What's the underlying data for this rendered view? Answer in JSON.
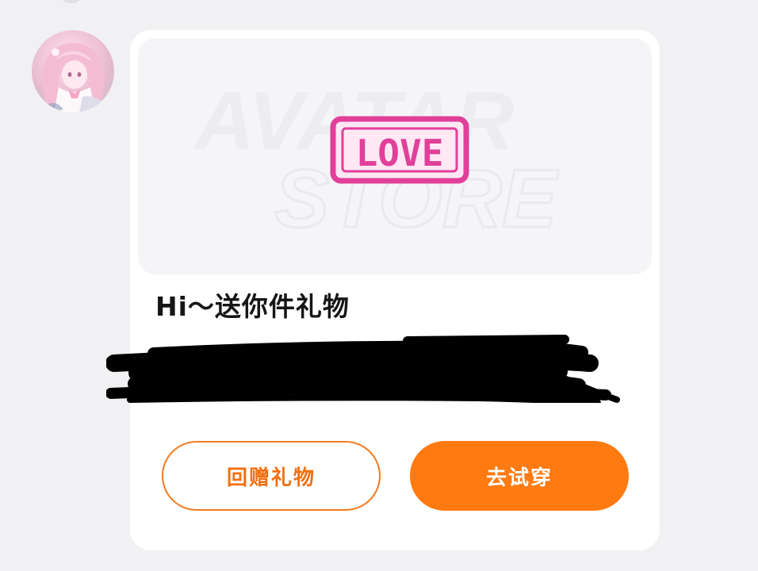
{
  "chat": {
    "sender_avatar": "anime-girl-avatar",
    "gift_card": {
      "banner": {
        "watermark_line1": "AVATAR",
        "watermark_line2": "STORE",
        "badge_text": "LOVE"
      },
      "title": "Hi～送你件礼物",
      "message": "",
      "buttons": {
        "return_gift": "回赠礼物",
        "try_on": "去试穿"
      }
    }
  },
  "colors": {
    "page_bg": "#f1f1f3",
    "card_bg": "#ffffff",
    "accent_orange": "#ff7a10",
    "badge_pink": "#e0409a"
  }
}
